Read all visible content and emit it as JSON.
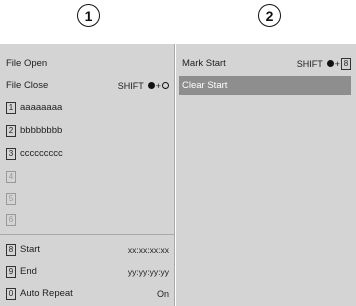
{
  "header": {
    "num1": "1",
    "num2": "2"
  },
  "panel1": {
    "file_open": "File Open",
    "file_close": "File Close",
    "file_close_shortcut": "SHIFT",
    "slots": [
      {
        "key": "1",
        "label": "aaaaaaaa"
      },
      {
        "key": "2",
        "label": "bbbbbbbb"
      },
      {
        "key": "3",
        "label": "ccccccccc"
      },
      {
        "key": "4",
        "label": ""
      },
      {
        "key": "5",
        "label": ""
      },
      {
        "key": "6",
        "label": ""
      }
    ],
    "start": {
      "key": "8",
      "label": "Start",
      "value": "xx:xx:xx:xx"
    },
    "end": {
      "key": "9",
      "label": "End",
      "value": "yy:yy:yy:yy"
    },
    "auto_repeat": {
      "key": "0",
      "label": "Auto Repeat",
      "value": "On"
    }
  },
  "panel2": {
    "mark_start": "Mark Start",
    "mark_start_shortcut": "SHIFT",
    "mark_start_key": "8",
    "clear_start": "Clear Start"
  },
  "colors": {
    "panel_bg": "#d4d4d4",
    "highlight": "#8e8e8e",
    "dim_text": "#9a9a9a"
  }
}
